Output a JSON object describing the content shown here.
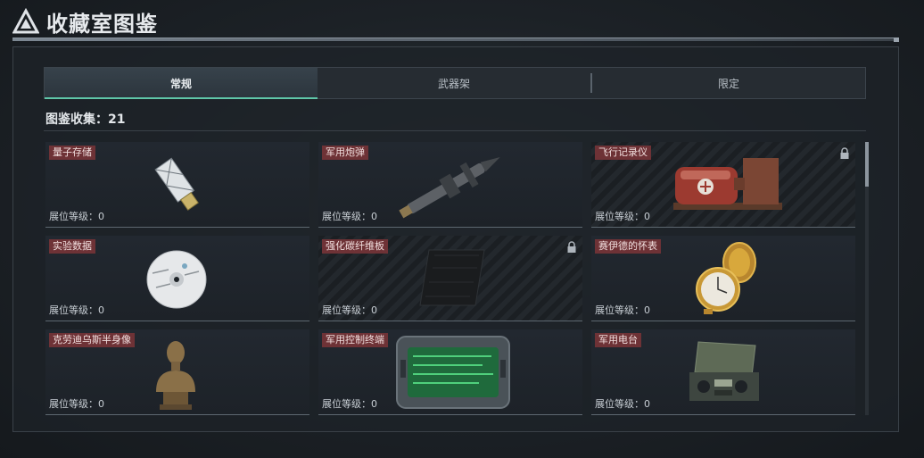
{
  "header": {
    "title": "收藏室图鉴",
    "logo_icon": "triangle-logo-icon"
  },
  "tabs": [
    {
      "label": "常规",
      "active": true
    },
    {
      "label": "武器架",
      "active": false
    },
    {
      "label": "限定",
      "active": false
    }
  ],
  "collection": {
    "label": "图鉴收集：21"
  },
  "items": [
    {
      "name": "量子存储",
      "level": "展位等级：0",
      "locked": false,
      "icon": "usb-drive-icon"
    },
    {
      "name": "军用炮弹",
      "level": "展位等级：0",
      "locked": false,
      "icon": "artillery-shell-icon"
    },
    {
      "name": "飞行记录仪",
      "level": "展位等级：0",
      "locked": true,
      "icon": "flight-recorder-icon"
    },
    {
      "name": "实验数据",
      "level": "展位等级：0",
      "locked": false,
      "icon": "cd-disc-icon"
    },
    {
      "name": "强化碳纤维板",
      "level": "展位等级：0",
      "locked": true,
      "icon": "carbon-plate-icon"
    },
    {
      "name": "赛伊德的怀表",
      "level": "展位等级：0",
      "locked": false,
      "icon": "pocket-watch-icon"
    },
    {
      "name": "克劳迪乌斯半身像",
      "level": "展位等级：0",
      "locked": false,
      "icon": "bust-statue-icon"
    },
    {
      "name": "军用控制终端",
      "level": "展位等级：0",
      "locked": false,
      "icon": "control-terminal-icon"
    },
    {
      "name": "军用电台",
      "level": "展位等级：0",
      "locked": false,
      "icon": "military-radio-icon"
    }
  ],
  "colors": {
    "accent": "#5fc6a8",
    "label_bg": "#6e3236"
  }
}
